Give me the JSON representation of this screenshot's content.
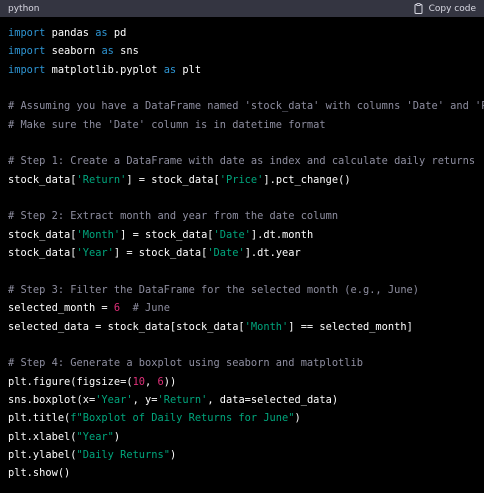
{
  "header": {
    "language": "python",
    "copy_label": "Copy code",
    "copy_icon": "clipboard-icon"
  },
  "colors": {
    "background": "#000000",
    "header_background": "#343541",
    "keyword": "#2e95d3",
    "comment": "#8e8ea0",
    "string": "#00a67d",
    "number": "#df3079",
    "text": "#ffffff"
  },
  "code": {
    "lines": [
      [
        {
          "k": "kw",
          "t": "import"
        },
        {
          "k": "txt",
          "t": " pandas "
        },
        {
          "k": "kw",
          "t": "as"
        },
        {
          "k": "txt",
          "t": " pd"
        }
      ],
      [
        {
          "k": "kw",
          "t": "import"
        },
        {
          "k": "txt",
          "t": " seaborn "
        },
        {
          "k": "kw",
          "t": "as"
        },
        {
          "k": "txt",
          "t": " sns"
        }
      ],
      [
        {
          "k": "kw",
          "t": "import"
        },
        {
          "k": "txt",
          "t": " matplotlib.pyplot "
        },
        {
          "k": "kw",
          "t": "as"
        },
        {
          "k": "txt",
          "t": " plt"
        }
      ],
      [],
      [
        {
          "k": "cm",
          "t": "# Assuming you have a DataFrame named 'stock_data' with columns 'Date' and 'Price'"
        }
      ],
      [
        {
          "k": "cm",
          "t": "# Make sure the 'Date' column is in datetime format"
        }
      ],
      [],
      [
        {
          "k": "cm",
          "t": "# Step 1: Create a DataFrame with date as index and calculate daily returns"
        }
      ],
      [
        {
          "k": "txt",
          "t": "stock_data["
        },
        {
          "k": "str",
          "t": "'Return'"
        },
        {
          "k": "txt",
          "t": "] = stock_data["
        },
        {
          "k": "str",
          "t": "'Price'"
        },
        {
          "k": "txt",
          "t": "].pct_change()"
        }
      ],
      [],
      [
        {
          "k": "cm",
          "t": "# Step 2: Extract month and year from the date column"
        }
      ],
      [
        {
          "k": "txt",
          "t": "stock_data["
        },
        {
          "k": "str",
          "t": "'Month'"
        },
        {
          "k": "txt",
          "t": "] = stock_data["
        },
        {
          "k": "str",
          "t": "'Date'"
        },
        {
          "k": "txt",
          "t": "].dt.month"
        }
      ],
      [
        {
          "k": "txt",
          "t": "stock_data["
        },
        {
          "k": "str",
          "t": "'Year'"
        },
        {
          "k": "txt",
          "t": "] = stock_data["
        },
        {
          "k": "str",
          "t": "'Date'"
        },
        {
          "k": "txt",
          "t": "].dt.year"
        }
      ],
      [],
      [
        {
          "k": "cm",
          "t": "# Step 3: Filter the DataFrame for the selected month (e.g., June)"
        }
      ],
      [
        {
          "k": "txt",
          "t": "selected_month = "
        },
        {
          "k": "num",
          "t": "6"
        },
        {
          "k": "txt",
          "t": "  "
        },
        {
          "k": "cm",
          "t": "# June"
        }
      ],
      [
        {
          "k": "txt",
          "t": "selected_data = stock_data[stock_data["
        },
        {
          "k": "str",
          "t": "'Month'"
        },
        {
          "k": "txt",
          "t": "] == selected_month]"
        }
      ],
      [],
      [
        {
          "k": "cm",
          "t": "# Step 4: Generate a boxplot using seaborn and matplotlib"
        }
      ],
      [
        {
          "k": "txt",
          "t": "plt.figure(figsize=("
        },
        {
          "k": "num",
          "t": "10"
        },
        {
          "k": "txt",
          "t": ", "
        },
        {
          "k": "num",
          "t": "6"
        },
        {
          "k": "txt",
          "t": "))"
        }
      ],
      [
        {
          "k": "txt",
          "t": "sns.boxplot(x="
        },
        {
          "k": "str",
          "t": "'Year'"
        },
        {
          "k": "txt",
          "t": ", y="
        },
        {
          "k": "str",
          "t": "'Return'"
        },
        {
          "k": "txt",
          "t": ", data=selected_data)"
        }
      ],
      [
        {
          "k": "txt",
          "t": "plt.title("
        },
        {
          "k": "str",
          "t": "f\"Boxplot of Daily Returns for June\""
        },
        {
          "k": "txt",
          "t": ")"
        }
      ],
      [
        {
          "k": "txt",
          "t": "plt.xlabel("
        },
        {
          "k": "str",
          "t": "\"Year\""
        },
        {
          "k": "txt",
          "t": ")"
        }
      ],
      [
        {
          "k": "txt",
          "t": "plt.ylabel("
        },
        {
          "k": "str",
          "t": "\"Daily Returns\""
        },
        {
          "k": "txt",
          "t": ")"
        }
      ],
      [
        {
          "k": "txt",
          "t": "plt.show()"
        }
      ]
    ]
  }
}
